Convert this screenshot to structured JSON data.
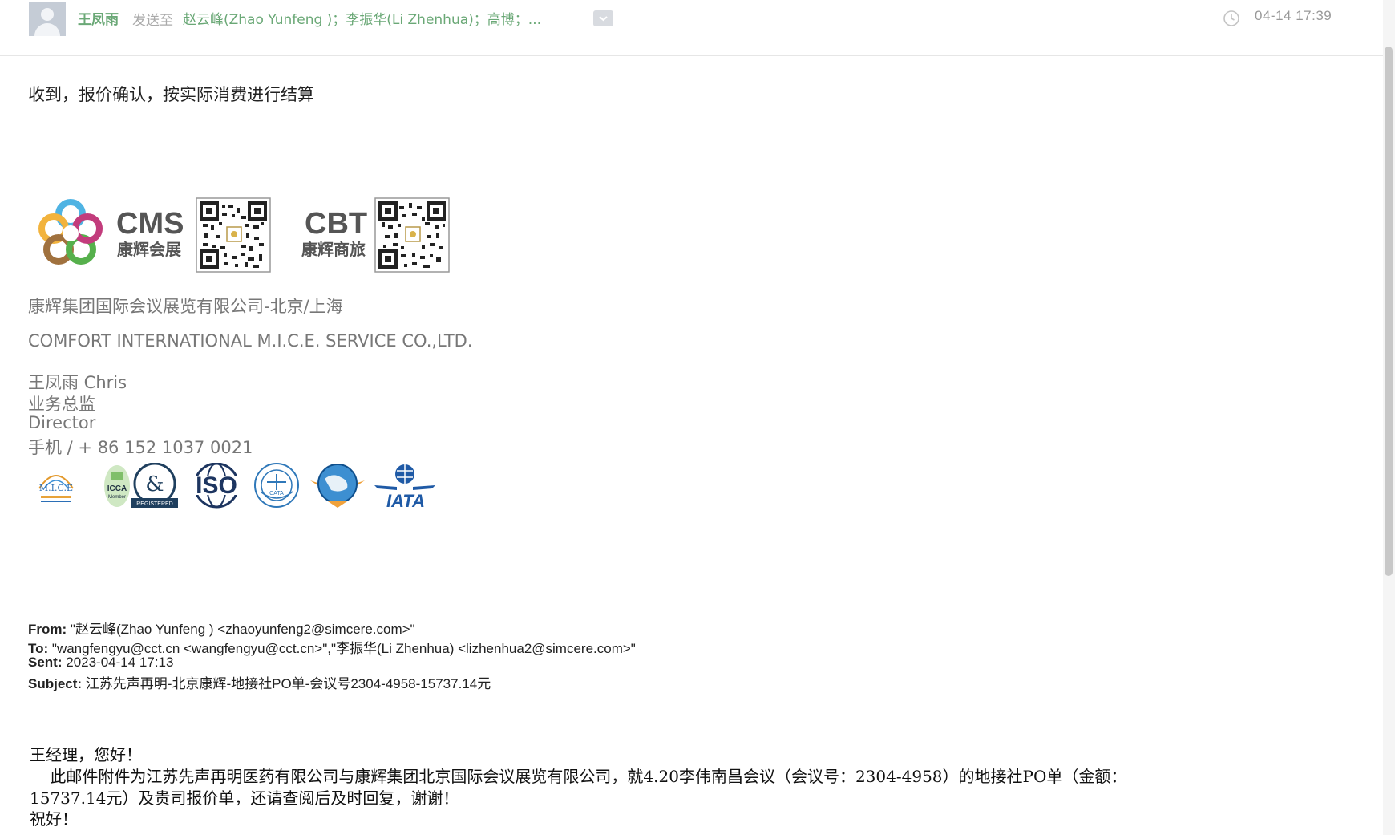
{
  "header": {
    "sender": "王凤雨",
    "send_to_label": "发送至",
    "recipients": "赵云峰(Zhao Yunfeng )；李振华(Li Zhenhua)；高博；...",
    "time": "04-14 17:39"
  },
  "reply": {
    "text": "收到，报价确认，按实际消费进行结算"
  },
  "logos": {
    "cms_title": "CMS",
    "cms_sub": "康辉会展",
    "cbt_title": "CBT",
    "cbt_sub": "康辉商旅"
  },
  "signature": {
    "company_cn": "康辉集团国际会议展览有限公司-北京/上海",
    "company_en": "COMFORT INTERNATIONAL M.I.C.E. SERVICE CO.,LTD.",
    "name": "王凤雨  Chris",
    "title_cn": "业务总监",
    "title_en": "Director",
    "phone": "手机 / + 86 152 1037 0021"
  },
  "certs": {
    "mice_label": "M.I.C.E",
    "icca_label": "ICCA",
    "icca_sub": "Member",
    "dnb_label": "&",
    "dnb_sub": "REGISTERED",
    "iso_label": "ISO",
    "cata_label": "CATA",
    "iata_label": "IATA"
  },
  "forwarded": {
    "from_label": "From:",
    "from_value": "\"赵云峰(Zhao Yunfeng ) <zhaoyunfeng2@simcere.com>\"",
    "to_label": "To:",
    "to_value": "\"wangfengyu@cct.cn <wangfengyu@cct.cn>\",\"李振华(Li Zhenhua) <lizhenhua2@simcere.com>\"",
    "sent_label": "Sent:",
    "sent_value": "2023-04-14 17:13",
    "subject_label": "Subject:",
    "subject_value": "江苏先声再明-北京康辉-地接社PO单-会议号2304-4958-15737.14元"
  },
  "letter": {
    "greeting": "王经理，您好！",
    "line1": "    此邮件附件为江苏先声再明医药有限公司与康辉集团北京国际会议展览有限公司，就4.20李伟南昌会议（会议号：2304-4958）的地接社PO单（金额：",
    "line2": "15737.14元）及贵司报价单，还请查阅后及时回复，谢谢！",
    "closing": "祝好！"
  }
}
